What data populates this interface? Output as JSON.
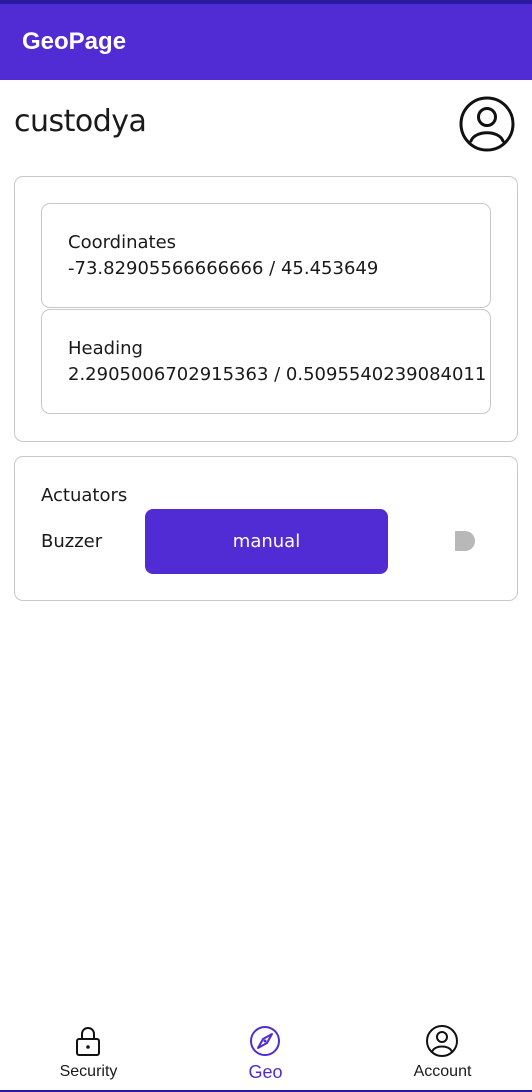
{
  "app": {
    "title": "GeoPage"
  },
  "user": {
    "name": "custodya"
  },
  "geo": {
    "coordinates": {
      "label": "Coordinates",
      "value": "-73.82905566666666 / 45.453649"
    },
    "heading": {
      "label": "Heading",
      "value": "2.2905006702915363 / 0.5095540239084011"
    }
  },
  "actuators": {
    "title": "Actuators",
    "buzzer": {
      "label": "Buzzer",
      "mode_button": "manual",
      "toggle_on": false
    }
  },
  "nav": {
    "items": [
      {
        "label": "Security",
        "icon": "lock-icon",
        "active": false
      },
      {
        "label": "Geo",
        "icon": "compass-icon",
        "active": true
      },
      {
        "label": "Account",
        "icon": "account-icon",
        "active": false
      }
    ]
  },
  "colors": {
    "primary": "#512bd4",
    "card_border": "#c8c8c8",
    "toggle_off": "#b8b8b8"
  }
}
